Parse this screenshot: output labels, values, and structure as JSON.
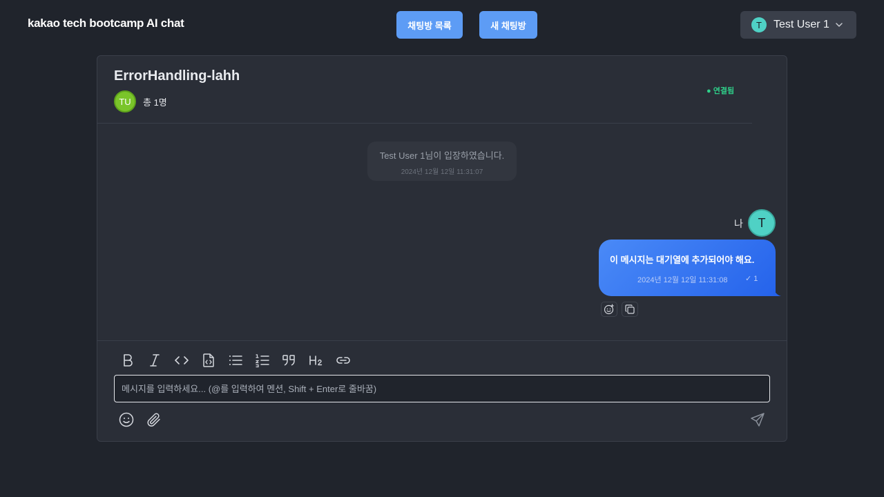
{
  "header": {
    "logo": "kakao tech bootcamp AI chat",
    "room_list_label": "채팅방 목록",
    "new_room_label": "새 채팅방",
    "user": {
      "initial": "T",
      "name": "Test User 1"
    }
  },
  "room": {
    "title": "ErrorHandling-lahh",
    "member_initials": "TU",
    "member_count": "총 1명",
    "status": "● 연결됨"
  },
  "messages": {
    "system": {
      "text": "Test User 1님이 입장하였습니다.",
      "time": "2024년 12월 12일 11:31:07"
    },
    "mine": {
      "sender_label": "나",
      "avatar_initial": "T",
      "text": "이 메시지는 대기열에 추가되어야 해요.",
      "time": "2024년 12월 12일 11:31:08",
      "read": "✓ 1"
    }
  },
  "composer": {
    "placeholder": "메시지를 입력하세요... (@를 입력하여 멘션, Shift + Enter로 줄바꿈)",
    "toolbar_icons": [
      "bold-icon",
      "italic-icon",
      "code-icon",
      "code-block-icon",
      "bullet-list-icon",
      "numbered-list-icon",
      "quote-icon",
      "heading-icon",
      "link-icon"
    ],
    "bottom_icons": [
      "emoji-icon",
      "attachment-icon",
      "send-icon"
    ]
  },
  "colors": {
    "background": "#20242c",
    "panel": "#2a2e37",
    "accent": "#5d9cf5",
    "bubble": "#3b7bf3",
    "status_online": "#2fd08a",
    "avatar_teal": "#4fd1c5",
    "avatar_green": "#7ac52a"
  }
}
